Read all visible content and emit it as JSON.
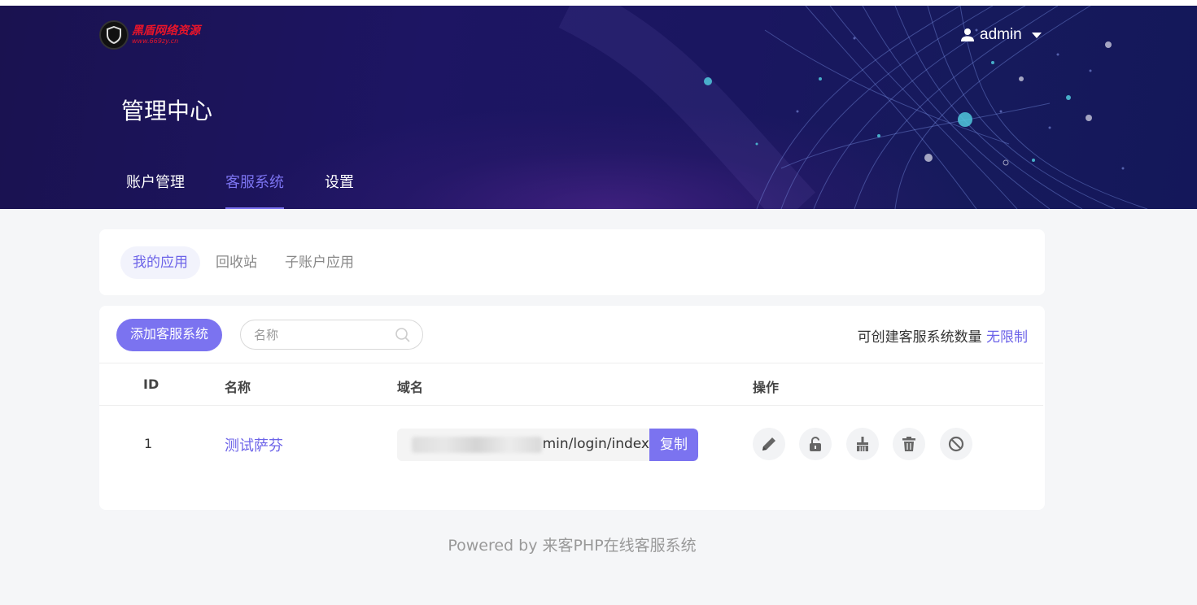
{
  "brand": {
    "logo_title": "黑盾网络资源",
    "logo_sub": "www.669zy.cn"
  },
  "user": {
    "name": "admin"
  },
  "header": {
    "title": "管理中心"
  },
  "main_nav": [
    {
      "label": "账户管理",
      "active": false
    },
    {
      "label": "客服系统",
      "active": true
    },
    {
      "label": "设置",
      "active": false
    }
  ],
  "tabs": [
    {
      "label": "我的应用",
      "active": true
    },
    {
      "label": "回收站",
      "active": false
    },
    {
      "label": "子账户应用",
      "active": false
    }
  ],
  "toolbar": {
    "add_label": "添加客服系统",
    "search_placeholder": "名称",
    "quota_label": "可创建客服系统数量",
    "quota_value": "无限制"
  },
  "table": {
    "columns": [
      "ID",
      "名称",
      "域名",
      "操作"
    ],
    "rows": [
      {
        "id": "1",
        "name": "测试萨芬",
        "domain": "min/login/index",
        "copy_label": "复制",
        "actions": [
          "edit-icon",
          "unlock-icon",
          "clean-icon",
          "trash-icon",
          "ban-icon"
        ]
      }
    ]
  },
  "footer": {
    "text": "Powered by 来客PHP在线客服系统"
  },
  "colors": {
    "accent": "#7b73f0",
    "header_bg": "#1b1460",
    "page_bg": "#f5f6f8"
  }
}
